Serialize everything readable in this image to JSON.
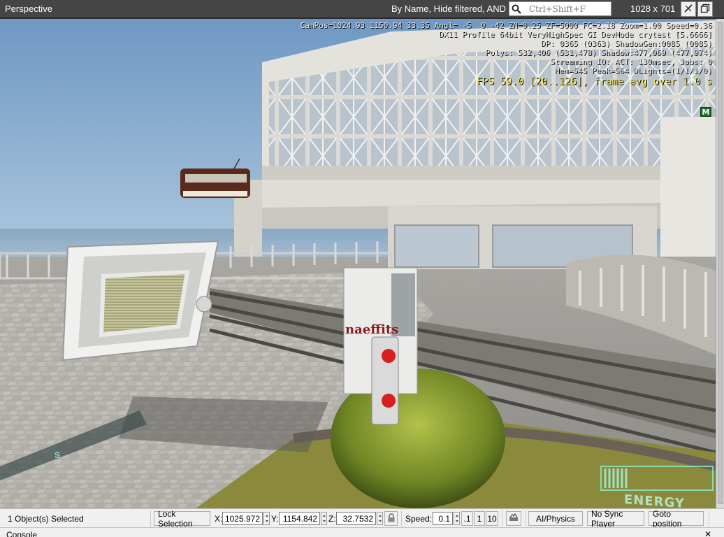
{
  "titlebar": {
    "title": "Perspective",
    "filter_label": "By Name, Hide filtered, AND",
    "search_placeholder": "Ctrl+Shift+F",
    "resolution": "1028 x 701"
  },
  "hud": {
    "line1": "CamPos=1024.93 1150.94 33.35 Angl= -5  0 -42 ZN=0.25 ZF=5000 FC=2.18 Zoom=1.00 Speed=0.36",
    "line2": "DX11 Profile 64bit VeryHighSpec GI DevMode crytest [5.6666]",
    "line3": "DP: 0365 (0363) ShadowGen:0085 (0085)",
    "line4": "Polys: 532,406 (531,478) Shadow:477,069 (477,974)",
    "line5": "Streaming IO: ACT: 130msec, Jobs: 0",
    "line6": "Mem=545 Peak=564 DLights=(1/1/1/0)",
    "fps": "FPS 59.0 [20..126], frame avg over 1.0 s",
    "marker": "M",
    "energy": "ENERGY",
    "s_glyph": "S"
  },
  "scene": {
    "sign_text": "naeffits"
  },
  "statusbar": {
    "selection": "1 Object(s) Selected",
    "lock_selection": "Lock Selection",
    "x_label": "X:",
    "x_value": "1025.972",
    "y_label": "Y:",
    "y_value": "1154.842",
    "z_label": "Z:",
    "z_value": "32.7532",
    "speed_label": "Speed:",
    "speed_value": "0.1",
    "speed_presets": [
      ".1",
      "1",
      "10"
    ],
    "ai_physics": "AI/Physics",
    "sync_player": "No Sync Player",
    "goto_position": "Goto position"
  },
  "console": {
    "title": "Console",
    "close": "✕"
  },
  "colors": {
    "titlebar_bg": "#454545",
    "hud_text": "#e8e8e8",
    "fps_text": "#f4e45a",
    "statusbar_bg": "#f0f0f0"
  }
}
